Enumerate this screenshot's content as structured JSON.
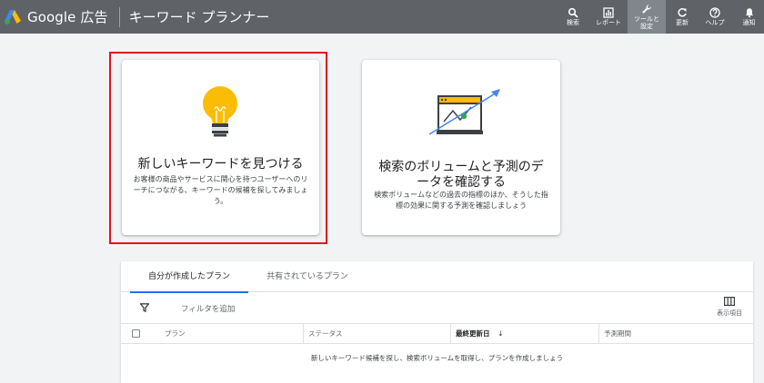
{
  "header": {
    "brand": "Google 広告",
    "app_title": "キーワード プランナー",
    "tools": [
      {
        "icon": "search-icon",
        "label": "検索"
      },
      {
        "icon": "reports-icon",
        "label": "レポート"
      },
      {
        "icon": "wrench-icon",
        "label": "ツールと\n設定",
        "active": true
      },
      {
        "icon": "refresh-icon",
        "label": "更新"
      },
      {
        "icon": "help-icon",
        "label": "ヘルプ"
      },
      {
        "icon": "bell-icon",
        "label": "通知"
      }
    ]
  },
  "cards": {
    "discover": {
      "title": "新しいキーワードを見つける",
      "description": "お客様の商品やサービスに関心を持つユーザーへのリーチにつながる、キーワードの候補を探してみましょう。"
    },
    "forecast": {
      "title": "検索のボリュームと予測のデータを確認する",
      "description": "検索ボリュームなどの過去の指標のほか、そうした指標の効果に関する予測を確認しましょう"
    }
  },
  "plans": {
    "tabs": [
      "自分が作成したプラン",
      "共有されているプラン"
    ],
    "filter_label": "フィルタを追加",
    "columns_label": "表示項目",
    "columns": [
      "プラン",
      "ステータス",
      "最終更新日",
      "予測期間"
    ],
    "sort_indicator": "↓",
    "empty_message": "新しいキーワード候補を探し、検索ボリュームを取得し、プランを作成しましょう"
  },
  "colors": {
    "header_bg": "#5f6368",
    "highlight": "#e1141b",
    "bulb": "#fbbc04",
    "accent_blue": "#1a73e8",
    "accent_green": "#34a853"
  }
}
